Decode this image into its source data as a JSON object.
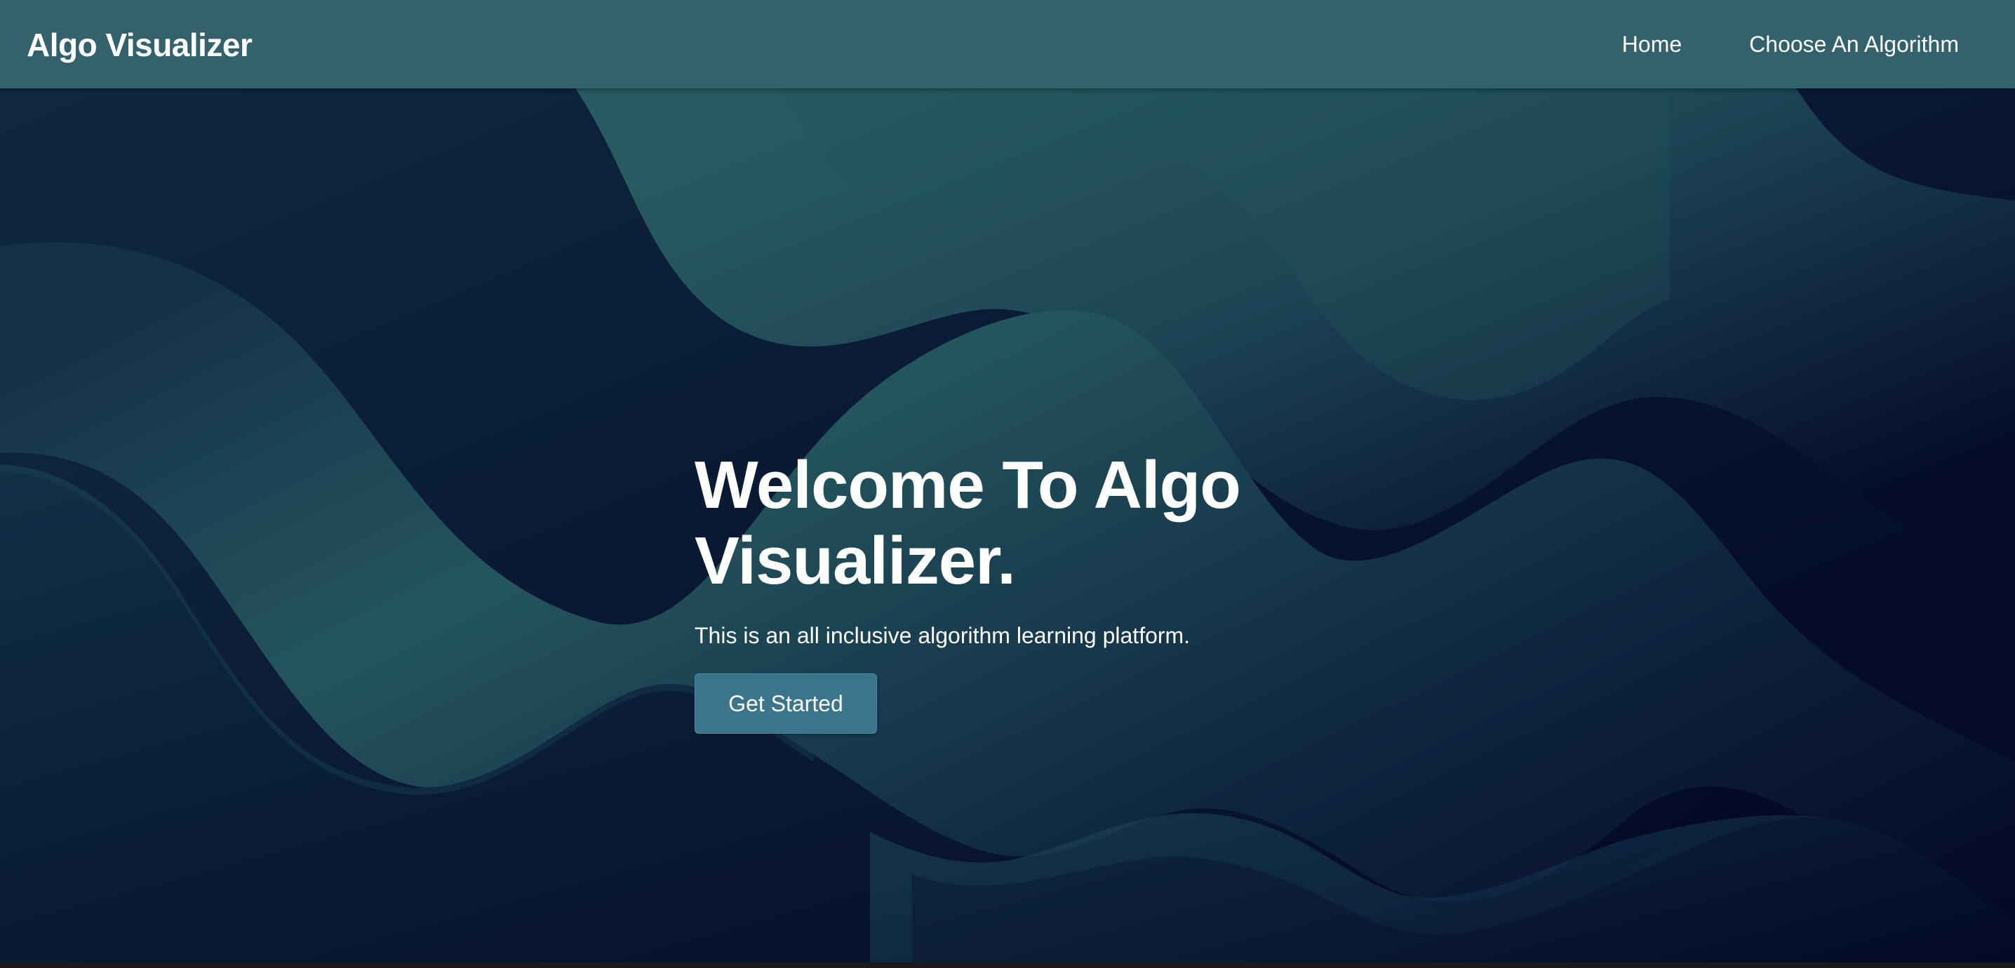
{
  "navbar": {
    "brand": "Algo Visualizer",
    "links": [
      {
        "label": "Home"
      },
      {
        "label": "Choose An Algorithm"
      }
    ]
  },
  "hero": {
    "title": "Welcome To Algo Visualizer.",
    "subtitle": "This is an all inclusive algorithm learning platform.",
    "cta_label": "Get Started"
  },
  "colors": {
    "navbar_bg": "#33626d",
    "wave_light": "#27575f",
    "wave_dark": "#050b2a",
    "button_bg": "#3b758c"
  }
}
